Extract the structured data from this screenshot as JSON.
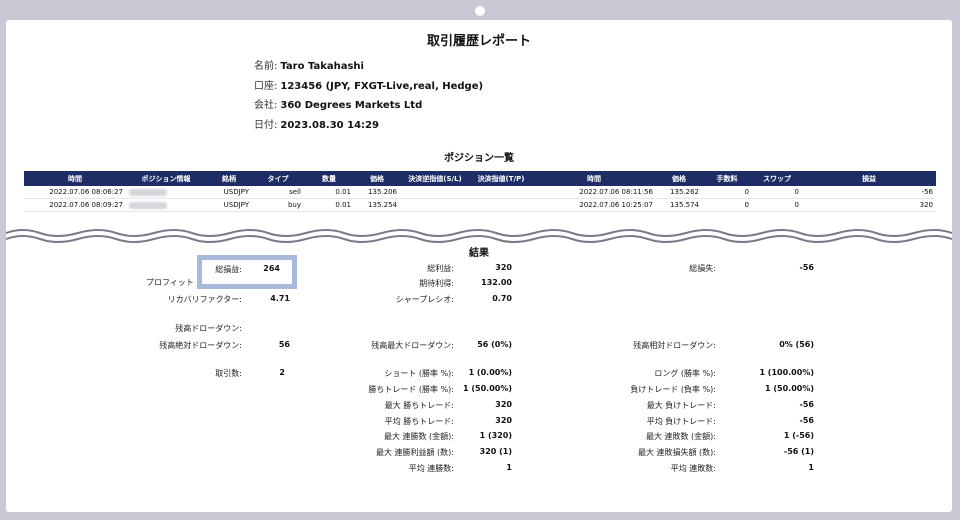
{
  "report": {
    "title": "取引履歴レポート",
    "name_label": "名前:",
    "name": "Taro Takahashi",
    "account_label": "口座:",
    "account": "123456 (JPY, FXGT-Live,real, Hedge)",
    "company_label": "会社:",
    "company": "360 Degrees Markets Ltd",
    "date_label": "日付:",
    "date": "2023.08.30 14:29"
  },
  "positions": {
    "title": "ポジション一覧",
    "headers": [
      "時間",
      "ポジション情報",
      "銘柄",
      "タイプ",
      "数量",
      "価格",
      "決済逆指値(S/L)",
      "決済指値(T/P)",
      "時間",
      "価格",
      "手数料",
      "スワップ",
      "損益"
    ],
    "rows": [
      [
        "2022.07.06 08:06:27",
        "",
        "USDJPY",
        "sell",
        "0.01",
        "135.206",
        "",
        "",
        "2022.07.06 08:11:56",
        "135.262",
        "0",
        "0",
        "-56"
      ],
      [
        "2022.07.06 08:09:27",
        "",
        "USDJPY",
        "buy",
        "0.01",
        "135.254",
        "",
        "",
        "2022.07.06 10:25:07",
        "135.574",
        "0",
        "0",
        "320"
      ]
    ]
  },
  "results": {
    "title": "結果",
    "net_profit_label": "総損益:",
    "net_profit": "264",
    "gross_profit_label": "総利益:",
    "gross_profit": "320",
    "gross_loss_label": "総損失:",
    "gross_loss": "-56",
    "profit_factor_label": "プロフィット",
    "profit_factor": "",
    "expected_payoff_label": "期待利得:",
    "expected_payoff": "132.00",
    "recovery_factor_label": "リカバリファクター:",
    "recovery_factor": "4.71",
    "sharpe_label": "シャープレシオ:",
    "sharpe": "0.70",
    "balance_dd_label": "残高ドローダウン:",
    "abs_dd_label": "残高絶対ドローダウン:",
    "abs_dd": "56",
    "max_dd_label": "残高最大ドローダウン:",
    "max_dd": "56 (0%)",
    "rel_dd_label": "残高相対ドローダウン:",
    "rel_dd": "0% (56)",
    "total_trades_label": "取引数:",
    "total_trades": "2",
    "short_label": "ショート (勝率 %):",
    "short": "1 (0.00%)",
    "long_label": "ロング (勝率 %):",
    "long": "1 (100.00%)",
    "win_label": "勝ちトレード (勝率 %):",
    "win": "1 (50.00%)",
    "loss_label": "負けトレード (負率 %):",
    "loss": "1 (50.00%)",
    "max_win_label": "最大 勝ちトレード:",
    "max_win": "320",
    "max_loss_label": "最大 負けトレード:",
    "max_loss": "-56",
    "avg_win_label": "平均 勝ちトレード:",
    "avg_win": "320",
    "avg_loss_label": "平均 負けトレード:",
    "avg_loss": "-56",
    "max_cons_win_label": "最大 連勝数 (金額):",
    "max_cons_win": "1 (320)",
    "max_cons_loss_label": "最大 連敗数 (金額):",
    "max_cons_loss": "1 (-56)",
    "max_cons_profit_label": "最大 連勝利益額 (数):",
    "max_cons_profit": "320 (1)",
    "max_cons_lossamt_label": "最大 連敗損失額 (数):",
    "max_cons_lossamt": "-56 (1)",
    "avg_cons_win_label": "平均 連勝数:",
    "avg_cons_win": "1",
    "avg_cons_loss_label": "平均 連敗数:",
    "avg_cons_loss": "1"
  }
}
